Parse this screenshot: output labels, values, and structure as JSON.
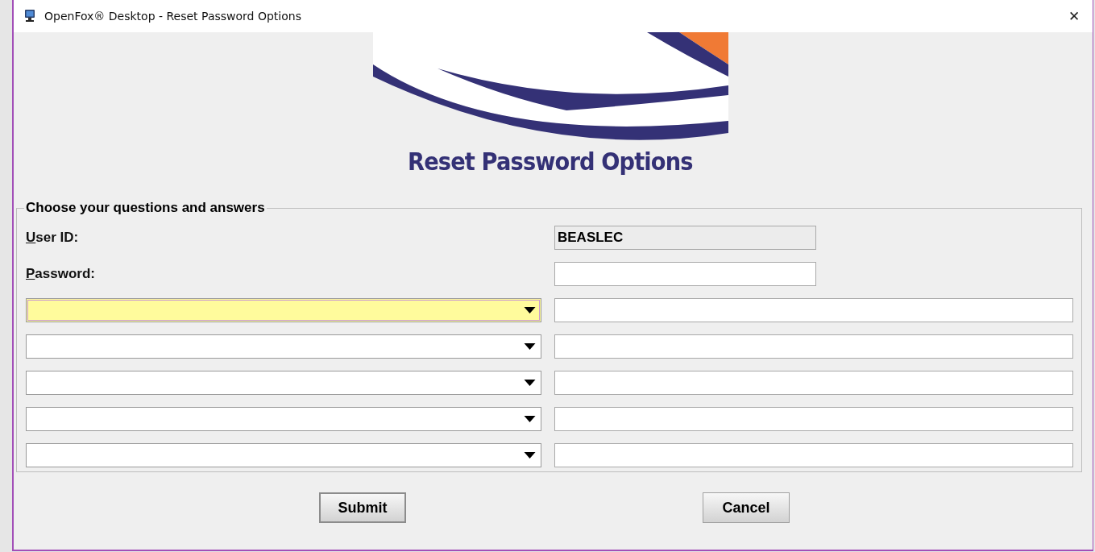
{
  "window": {
    "title": "OpenFox® Desktop - Reset Password Options",
    "close": "✕"
  },
  "banner": {
    "heading": "Reset Password Options"
  },
  "form": {
    "legend": "Choose your questions and answers",
    "user_id": {
      "label": "User ID:",
      "value": "BEASLEC",
      "readonly": true
    },
    "password": {
      "label": "Password:"
    },
    "questions": [
      {
        "focused": true
      },
      {
        "focused": false
      },
      {
        "focused": false
      },
      {
        "focused": false
      },
      {
        "focused": false
      }
    ]
  },
  "buttons": [
    {
      "label": "Submit",
      "default": true
    },
    {
      "label": "Cancel",
      "default": false
    }
  ]
}
